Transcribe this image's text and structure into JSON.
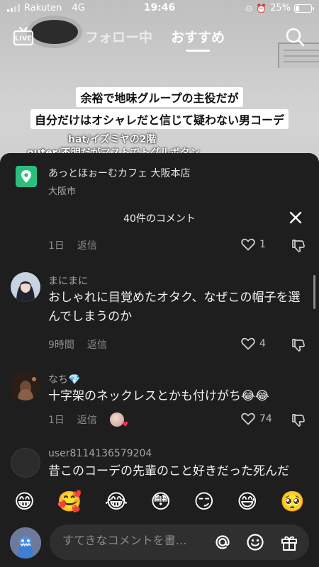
{
  "status": {
    "carrier": "Rakuten",
    "network": "4G",
    "time": "19:46",
    "battery": "25%",
    "battery_level": 0.25
  },
  "nav": {
    "live": "LIVE",
    "tabs": [
      "フォロー中",
      "おすすめ"
    ]
  },
  "caption": {
    "line1": "余裕で地味グループの主役だが",
    "line2": "自分だけはオシャレだと信じて疑わない男コーデ",
    "overlay1": "hat/イズミヤの2階",
    "overlay2": "outer/不明だがマストでトグルボタン"
  },
  "location": {
    "name": "あっとほぉーむカフェ 大阪本店",
    "city": "大阪市"
  },
  "comments_title": "40件のコメント",
  "top_meta": {
    "time": "1日",
    "reply": "返信",
    "likes": "1"
  },
  "comments": [
    {
      "user": "まにまに",
      "text": "おしゃれに目覚めたオタク、なぜこの帽子を選んでしまうのか",
      "time": "9時間",
      "reply": "返信",
      "likes": "4"
    },
    {
      "user": "なち💎",
      "text": "十字架のネックレスとかも付けがち😂😂",
      "time": "1日",
      "reply": "返信",
      "likes": "74"
    },
    {
      "user": "user8114136579204",
      "text": "昔このコーデの先輩のこと好きだった死んだ"
    }
  ],
  "emojis": [
    "😁",
    "🥰",
    "😂",
    "😳",
    "😏",
    "😅",
    "🥺"
  ],
  "input": {
    "placeholder": "すてきなコメントを書…"
  },
  "colors": {
    "sheet": "#1e1e1e",
    "location_icon": "#2bbf7d",
    "heart_badge": "#ff2f55"
  },
  "icons": [
    "live-icon",
    "search-icon",
    "location-pin-icon",
    "close-icon",
    "heart-icon",
    "dislike-icon",
    "at-icon",
    "emoji-icon",
    "gift-icon"
  ]
}
